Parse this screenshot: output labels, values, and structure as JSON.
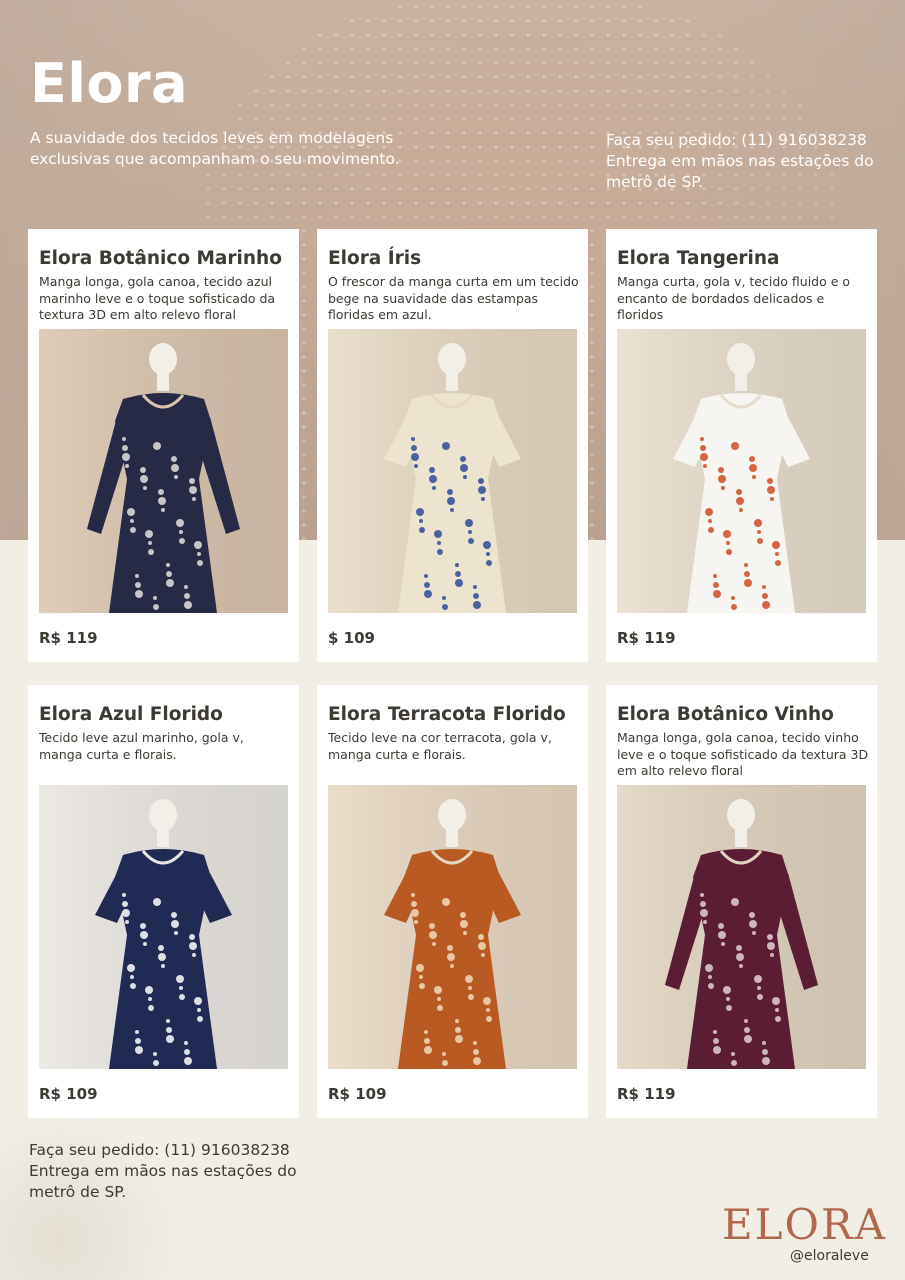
{
  "brand": {
    "title": "Elora",
    "tagline": "A suavidade dos tecidos leves em modelagens exclusivas que acompanham o seu movimento.",
    "logo_text": "ELORA",
    "handle": "@eloraleve"
  },
  "contact": {
    "line1": "Faça seu pedido: (11) 916038238",
    "line2": "Entrega em mãos nas estações do",
    "line3": "metrô de SP."
  },
  "products": [
    {
      "name": "Elora Botânico Marinho",
      "description": "Manga longa, gola canoa, tecido azul marinho leve e o toque sofisticado da textura 3D em alto relevo floral",
      "price": "R$ 119",
      "colors": {
        "dress": "#262a45",
        "accent": "#e4e1dc",
        "bg": "#d9c4ae"
      }
    },
    {
      "name": "Elora Íris",
      "description": "O frescor da manga curta em um tecido bege na suavidade das estampas floridas em azul.",
      "price": "$ 109",
      "colors": {
        "dress": "#ece4cf",
        "accent": "#2e4a9a",
        "bg": "#e6d9c3"
      }
    },
    {
      "name": "Elora Tangerina",
      "description": "Manga curta, gola v, tecido fluido e o encanto de bordados delicados e floridos",
      "price": "R$ 119",
      "colors": {
        "dress": "#f7f5f1",
        "accent": "#cf4a25",
        "bg": "#e8ddcc"
      }
    },
    {
      "name": "Elora Azul Florido",
      "description": "Tecido leve azul marinho, gola v, manga curta e florais.",
      "price": "R$ 109",
      "colors": {
        "dress": "#202a52",
        "accent": "#ffffff",
        "bg": "#e9e6e1"
      }
    },
    {
      "name": "Elora Terracota Florido",
      "description": "Tecido leve na cor terracota, gola v, manga curta e florais.",
      "price": "R$ 109",
      "colors": {
        "dress": "#b85a22",
        "accent": "#f2d9b8",
        "bg": "#e7d7c1"
      }
    },
    {
      "name": "Elora Botânico Vinho",
      "description": "Manga longa, gola canoa, tecido vinho leve e o toque sofisticado da textura 3D em alto relevo floral",
      "price": "R$ 119",
      "colors": {
        "dress": "#5a1d33",
        "accent": "#e2cfd6",
        "bg": "#e1d3c1"
      }
    }
  ]
}
